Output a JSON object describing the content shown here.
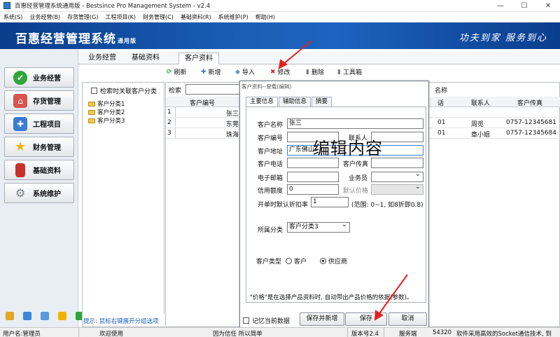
{
  "window": {
    "title": "百惠经营管理系统通用版 - Bestsince Pro Management System - v2.4",
    "min": "—",
    "max": "☐",
    "close": "✕"
  },
  "menu": [
    "系统(S)",
    "业务经营(B)",
    "存货管理(G)",
    "工程项目(K)",
    "财务管理(C)",
    "基础资料(R)",
    "系统维护(P)",
    "帮助(H)"
  ],
  "banner": {
    "name": "百惠经营管理系统",
    "edition": "通用版",
    "slogan": "功夫到家  服务到心"
  },
  "sidebar": {
    "items": [
      {
        "label": "业务经营",
        "icon": "check-circle-icon",
        "color": "#2fa53a"
      },
      {
        "label": "存货管理",
        "icon": "home-icon",
        "color": "#d9534f"
      },
      {
        "label": "工程项目",
        "icon": "puzzle-icon",
        "color": "#3a7bd5"
      },
      {
        "label": "财务管理",
        "icon": "star-icon",
        "color": "#f0b400"
      },
      {
        "label": "基础资料",
        "icon": "book-icon",
        "color": "#c9302c"
      },
      {
        "label": "系统维护",
        "icon": "gear-icon",
        "color": "#7a7f86"
      }
    ]
  },
  "tabs": [
    "业务经营",
    "基础资料",
    "客户资料"
  ],
  "toolbar": {
    "refresh": "刷新",
    "add": "新增",
    "import": "导入",
    "edit": "修改",
    "delete": "删除",
    "tools": "工具箱"
  },
  "leftpane": {
    "checkbox": "检索时关联客户分类",
    "tree": [
      "客户分类1",
      "客户分类2",
      "客户分类3"
    ],
    "tip": "提示: 鼠标右键展开分组选项"
  },
  "grid": {
    "search_label": "检索",
    "right_label": "名称",
    "headers": [
      "客户编号",
      "话",
      "联系人",
      "客户传真"
    ],
    "rows": [
      {
        "n": "1",
        "name": "张三",
        "tel": "",
        "contact": "",
        "fax": ""
      },
      {
        "n": "2",
        "name": "东莞",
        "tel": "01",
        "contact": "周觅",
        "fax": "0757-12345681"
      },
      {
        "n": "3",
        "name": "珠海",
        "tel": "01",
        "contact": "章小姐",
        "fax": "0757-12345684"
      }
    ]
  },
  "dialog": {
    "title": "客户资料--登载(编辑)",
    "tabs": [
      "主要信息",
      "辅助信息",
      "摘要"
    ],
    "fields": {
      "name_label": "客户名称",
      "name_value": "张三",
      "code_label": "客户编号",
      "code_value": "",
      "contact_label": "联系人",
      "contact_value": "",
      "address_label": "客户地址",
      "address_value": "广东佛山",
      "phone_label": "客户电话",
      "phone_value": "",
      "fax_label": "客户传真",
      "fax_value": "",
      "email_label": "电子邮箱",
      "email_value": "",
      "sales_label": "业务员",
      "sales_value": "",
      "credit_label": "信用额度",
      "credit_value": "0",
      "price_label": "默认价格",
      "price_value": "",
      "discount_label": "开单时默认折扣率",
      "discount_value": "1",
      "discount_hint": "(范围: 0~1, 如8折即0.8)",
      "category_label": "所属分类",
      "category_value": "客户分类3",
      "type_label": "客户类型",
      "type_customer": "客户",
      "type_supplier": "供应商"
    },
    "note": "\"价格\"是在选择产品资料时, 自动带出产品价格的依据(参数)。",
    "remember": "记忆当前数据",
    "btn_save_new": "保存并新增",
    "btn_save": "保存",
    "btn_cancel": "取消"
  },
  "annotation": "编辑内容",
  "status": {
    "user": "用户名:管理员",
    "welcome": "欢迎使用",
    "msg": "因为信任 所以简单",
    "version": "版本号2.4",
    "server": "服务端",
    "port": "54320",
    "footer": "软件采用高效的Socket通信技术, 到"
  }
}
